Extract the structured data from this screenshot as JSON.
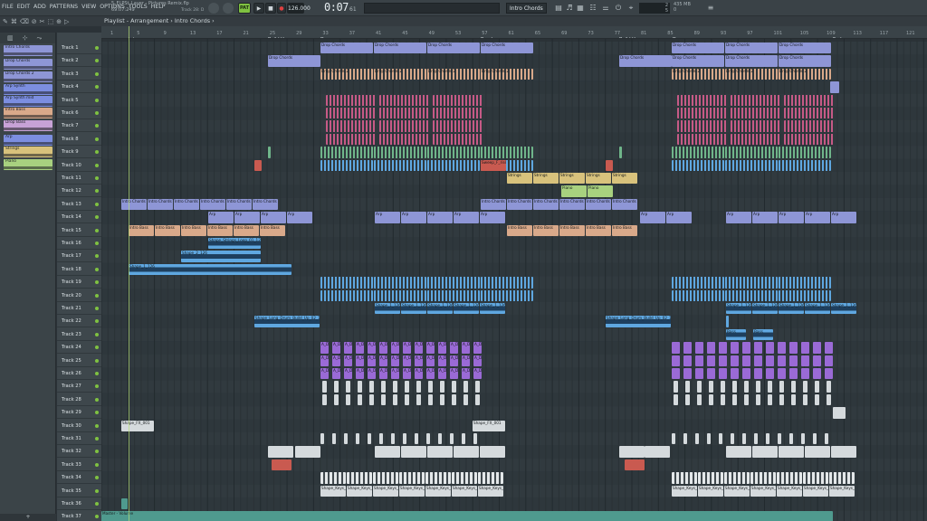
{
  "menu": [
    "FILE",
    "EDIT",
    "ADD",
    "PATTERNS",
    "VIEW",
    "OPTIONS",
    "TOOLS",
    "HELP"
  ],
  "song": {
    "filename": "5_FLPSt_Layer - Pictures Remix.flp",
    "position": "69:07:249",
    "track_hint": "Track 28: D"
  },
  "transport": {
    "pattern_label": "PAT",
    "tempo": "126.000",
    "time": "0:07",
    "time_sub": "61"
  },
  "pattern_selector": "Intro Chords",
  "status": {
    "cpu_top": "2",
    "cpu_bottom": "5",
    "mem": "435 MB",
    "mem_sub": "0"
  },
  "breadcrumb": "Playlist - Arrangement › Intro Chords ›",
  "picker": {
    "bottom_label": "+",
    "clips": [
      {
        "name": "Intro Chords",
        "color": "#8e96d6"
      },
      {
        "name": "Drop Chords",
        "color": "#8e96d6"
      },
      {
        "name": "Drop Chords 2",
        "color": "#8e96d6"
      },
      {
        "name": "Arp Synth",
        "color": "#7c8ee0"
      },
      {
        "name": "Arp Synth mid",
        "color": "#7c8ee0"
      },
      {
        "name": "Intro Bass",
        "color": "#d9a98a"
      },
      {
        "name": "Drop Bass",
        "color": "#c7a2d6"
      },
      {
        "name": "Arp",
        "color": "#7c8ee0"
      },
      {
        "name": "Strings",
        "color": "#d8c27c"
      },
      {
        "name": "Piano",
        "color": "#a8d17f"
      }
    ]
  },
  "tracks": [
    "Track 1",
    "Track 2",
    "Track 3",
    "Track 4",
    "Track 5",
    "Track 6",
    "Track 7",
    "Track 8",
    "Track 9",
    "Track 10",
    "Track 11",
    "Track 12",
    "Track 13",
    "Track 14",
    "Track 15",
    "Track 16",
    "Track 17",
    "Track 18",
    "Track 19",
    "Track 20",
    "Track 21",
    "Track 22",
    "Track 23",
    "Track 24",
    "Track 25",
    "Track 26",
    "Track 27",
    "Track 28",
    "Track 29",
    "Track 30",
    "Track 31",
    "Track 32",
    "Track 33",
    "Track 34",
    "Track 35",
    "Track 36",
    "Track 37"
  ],
  "ruler_numbers": [
    "1",
    "5",
    "9",
    "13",
    "17",
    "21",
    "25",
    "29",
    "33",
    "37",
    "41",
    "45",
    "49",
    "53",
    "57",
    "61",
    "65",
    "69",
    "73",
    "77",
    "81",
    "85",
    "89",
    "93",
    "97",
    "101",
    "105",
    "109",
    "113",
    "117",
    "121"
  ],
  "markers": [
    "Intro",
    "Build Up",
    "Drop",
    "Break",
    "Build Up",
    "Drop",
    "End"
  ],
  "clip_labels": {
    "intro": "Intro Chords",
    "drop": "Drop Chords",
    "drop2": "Drop Chords 2",
    "arp": "Arp",
    "bass": "Intro Bass",
    "strings": "Strings",
    "piano": "Piano",
    "sweep": "Sweep_F_rise 1",
    "shape1": "Shape_1_126",
    "shape2": "Shape_2_126",
    "strshape": "Shape_Strings_Loop_01_126",
    "vocal": "Shape_Long_Drum_Build_Up_02_126",
    "bass2": "Bass",
    "chord": "A_D",
    "master": "Master - Volume",
    "fx": "Shape_FX_001",
    "keys": "Shape_Keys_Loop_01_126"
  },
  "colors": {
    "chords": "#8e96d6",
    "bass": "#d9a98a",
    "synth": "#c65a86",
    "pluck": "#6fb58a",
    "strings": "#d8c27c",
    "piano": "#a8d17f",
    "blue": "#5fa7e0",
    "purple": "#9a6ad6",
    "white": "#d5dadd",
    "red": "#c95a50",
    "teal": "#4f9a8e"
  }
}
